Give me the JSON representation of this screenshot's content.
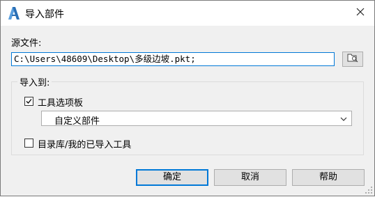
{
  "window": {
    "title": "导入部件",
    "app_icon": "autocad-a-icon",
    "close_icon": "close-icon"
  },
  "source": {
    "label": "源文件:",
    "path_value": "C:\\Users\\48609\\Desktop\\多级边坡.pkt;",
    "browse_icon": "browse-folder-icon"
  },
  "import_to": {
    "label": "导入到:",
    "tool_palette": {
      "label": "工具选项板",
      "checked": true
    },
    "palette_select": {
      "value": "自定义部件"
    },
    "catalog": {
      "label": "目录库/我的已导入工具",
      "checked": false
    }
  },
  "buttons": {
    "ok": "确定",
    "cancel": "取消",
    "help": "帮助"
  },
  "colors": {
    "accent": "#0078d7",
    "title_bg": "#ffffff",
    "body_bg": "#f0f0f0"
  }
}
